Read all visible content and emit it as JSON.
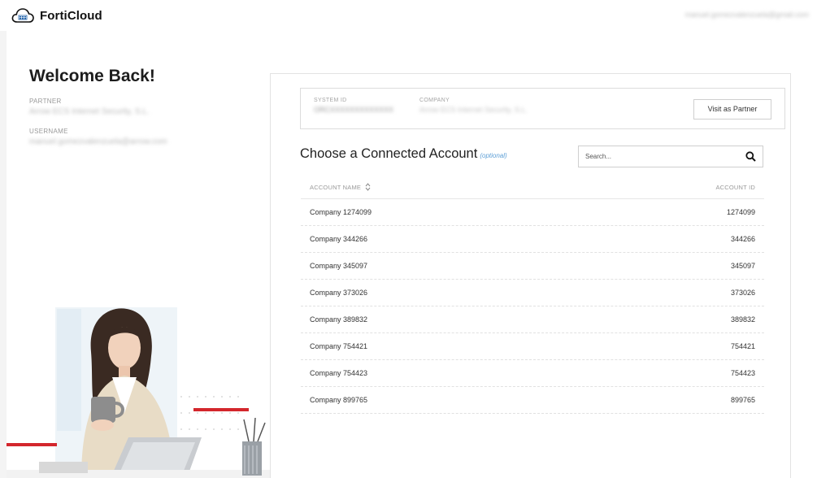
{
  "header": {
    "app_name": "FortiCloud",
    "user_email": "manuel.gomezvalenzuela@gmail.com"
  },
  "welcome": {
    "title": "Welcome Back!",
    "partner_label": "PARTNER",
    "partner_value": "Arrow ECS Internet Security, S.L.",
    "username_label": "USERNAME",
    "username_value": "manuel.gomezvalenzuela@arrow.com"
  },
  "system": {
    "system_id_label": "SYSTEM ID",
    "system_id_value": "ORCXXXXXXXXXXXXX",
    "company_label": "COMPANY",
    "company_value": "Arrow ECS Internet Security, S.L.",
    "visit_button": "Visit as Partner"
  },
  "accounts": {
    "title": "Choose a Connected Account",
    "optional_label": "(optional)",
    "search_placeholder": "Search...",
    "columns": [
      "ACCOUNT NAME",
      "ACCOUNT ID"
    ],
    "rows": [
      {
        "name": "Company 1274099",
        "id": "1274099"
      },
      {
        "name": "Company 344266",
        "id": "344266"
      },
      {
        "name": "Company 345097",
        "id": "345097"
      },
      {
        "name": "Company 373026",
        "id": "373026"
      },
      {
        "name": "Company 389832",
        "id": "389832"
      },
      {
        "name": "Company 754421",
        "id": "754421"
      },
      {
        "name": "Company 754423",
        "id": "754423"
      },
      {
        "name": "Company 899765",
        "id": "899765"
      }
    ]
  },
  "icons": {
    "logo": "cloud-logo-icon",
    "search": "search-icon",
    "sort": "sort-icon"
  },
  "colors": {
    "accent_red": "#d3262c",
    "optional_blue": "#5d9fd6"
  }
}
